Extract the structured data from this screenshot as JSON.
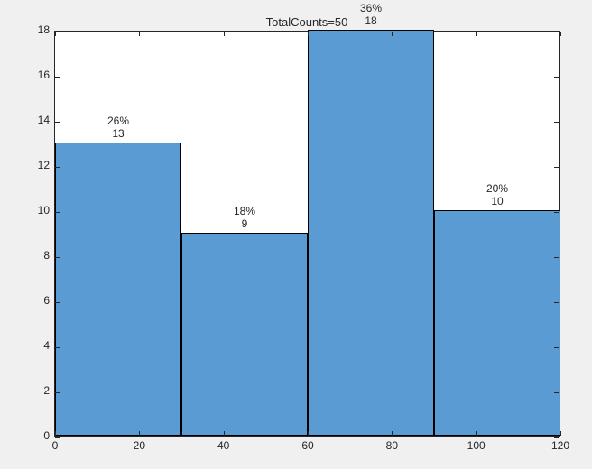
{
  "chart_data": {
    "type": "bar",
    "title": "TotalCounts=50",
    "bin_edges": [
      0,
      30,
      60,
      90,
      120
    ],
    "values": [
      13,
      9,
      18,
      10
    ],
    "percentages": [
      "26%",
      "18%",
      "36%",
      "20%"
    ],
    "counts_labels": [
      "13",
      "9",
      "18",
      "10"
    ],
    "xlim": [
      0,
      120
    ],
    "ylim": [
      0,
      18
    ],
    "xticks": [
      0,
      20,
      40,
      60,
      80,
      100,
      120
    ],
    "yticks": [
      0,
      2,
      4,
      6,
      8,
      10,
      12,
      14,
      16,
      18
    ],
    "bar_color": "#5b9bd3"
  },
  "xtick_labels": [
    "0",
    "20",
    "40",
    "60",
    "80",
    "100",
    "120"
  ],
  "ytick_labels": [
    "0",
    "2",
    "4",
    "6",
    "8",
    "10",
    "12",
    "14",
    "16",
    "18"
  ]
}
